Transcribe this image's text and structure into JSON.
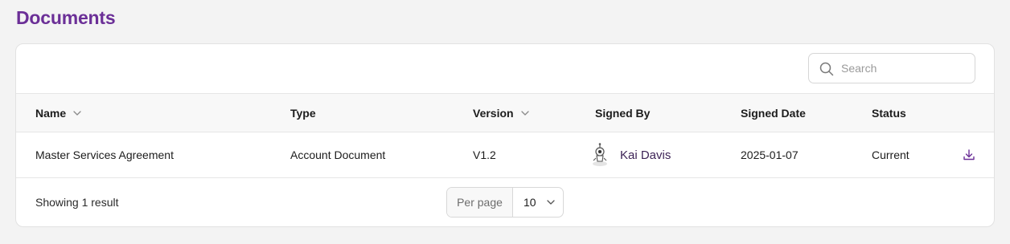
{
  "page": {
    "title": "Documents"
  },
  "search": {
    "placeholder": "Search",
    "value": "",
    "icon": "search-icon"
  },
  "table": {
    "columns": [
      {
        "label": "Name",
        "sortable": true
      },
      {
        "label": "Type",
        "sortable": false
      },
      {
        "label": "Version",
        "sortable": true
      },
      {
        "label": "Signed By",
        "sortable": false
      },
      {
        "label": "Signed Date",
        "sortable": false
      },
      {
        "label": "Status",
        "sortable": false
      }
    ],
    "rows": [
      {
        "name": "Master Services Agreement",
        "type": "Account Document",
        "version": "V1.2",
        "signed_by": "Kai Davis",
        "signed_date": "2025-01-07",
        "status": "Current",
        "action_icon": "download-icon"
      }
    ]
  },
  "footer": {
    "result_text": "Showing 1 result",
    "per_page_label": "Per page",
    "per_page_value": "10"
  },
  "colors": {
    "title": "#6b2f97",
    "download_icon": "#6b2f97",
    "signer_name": "#3e2457"
  }
}
